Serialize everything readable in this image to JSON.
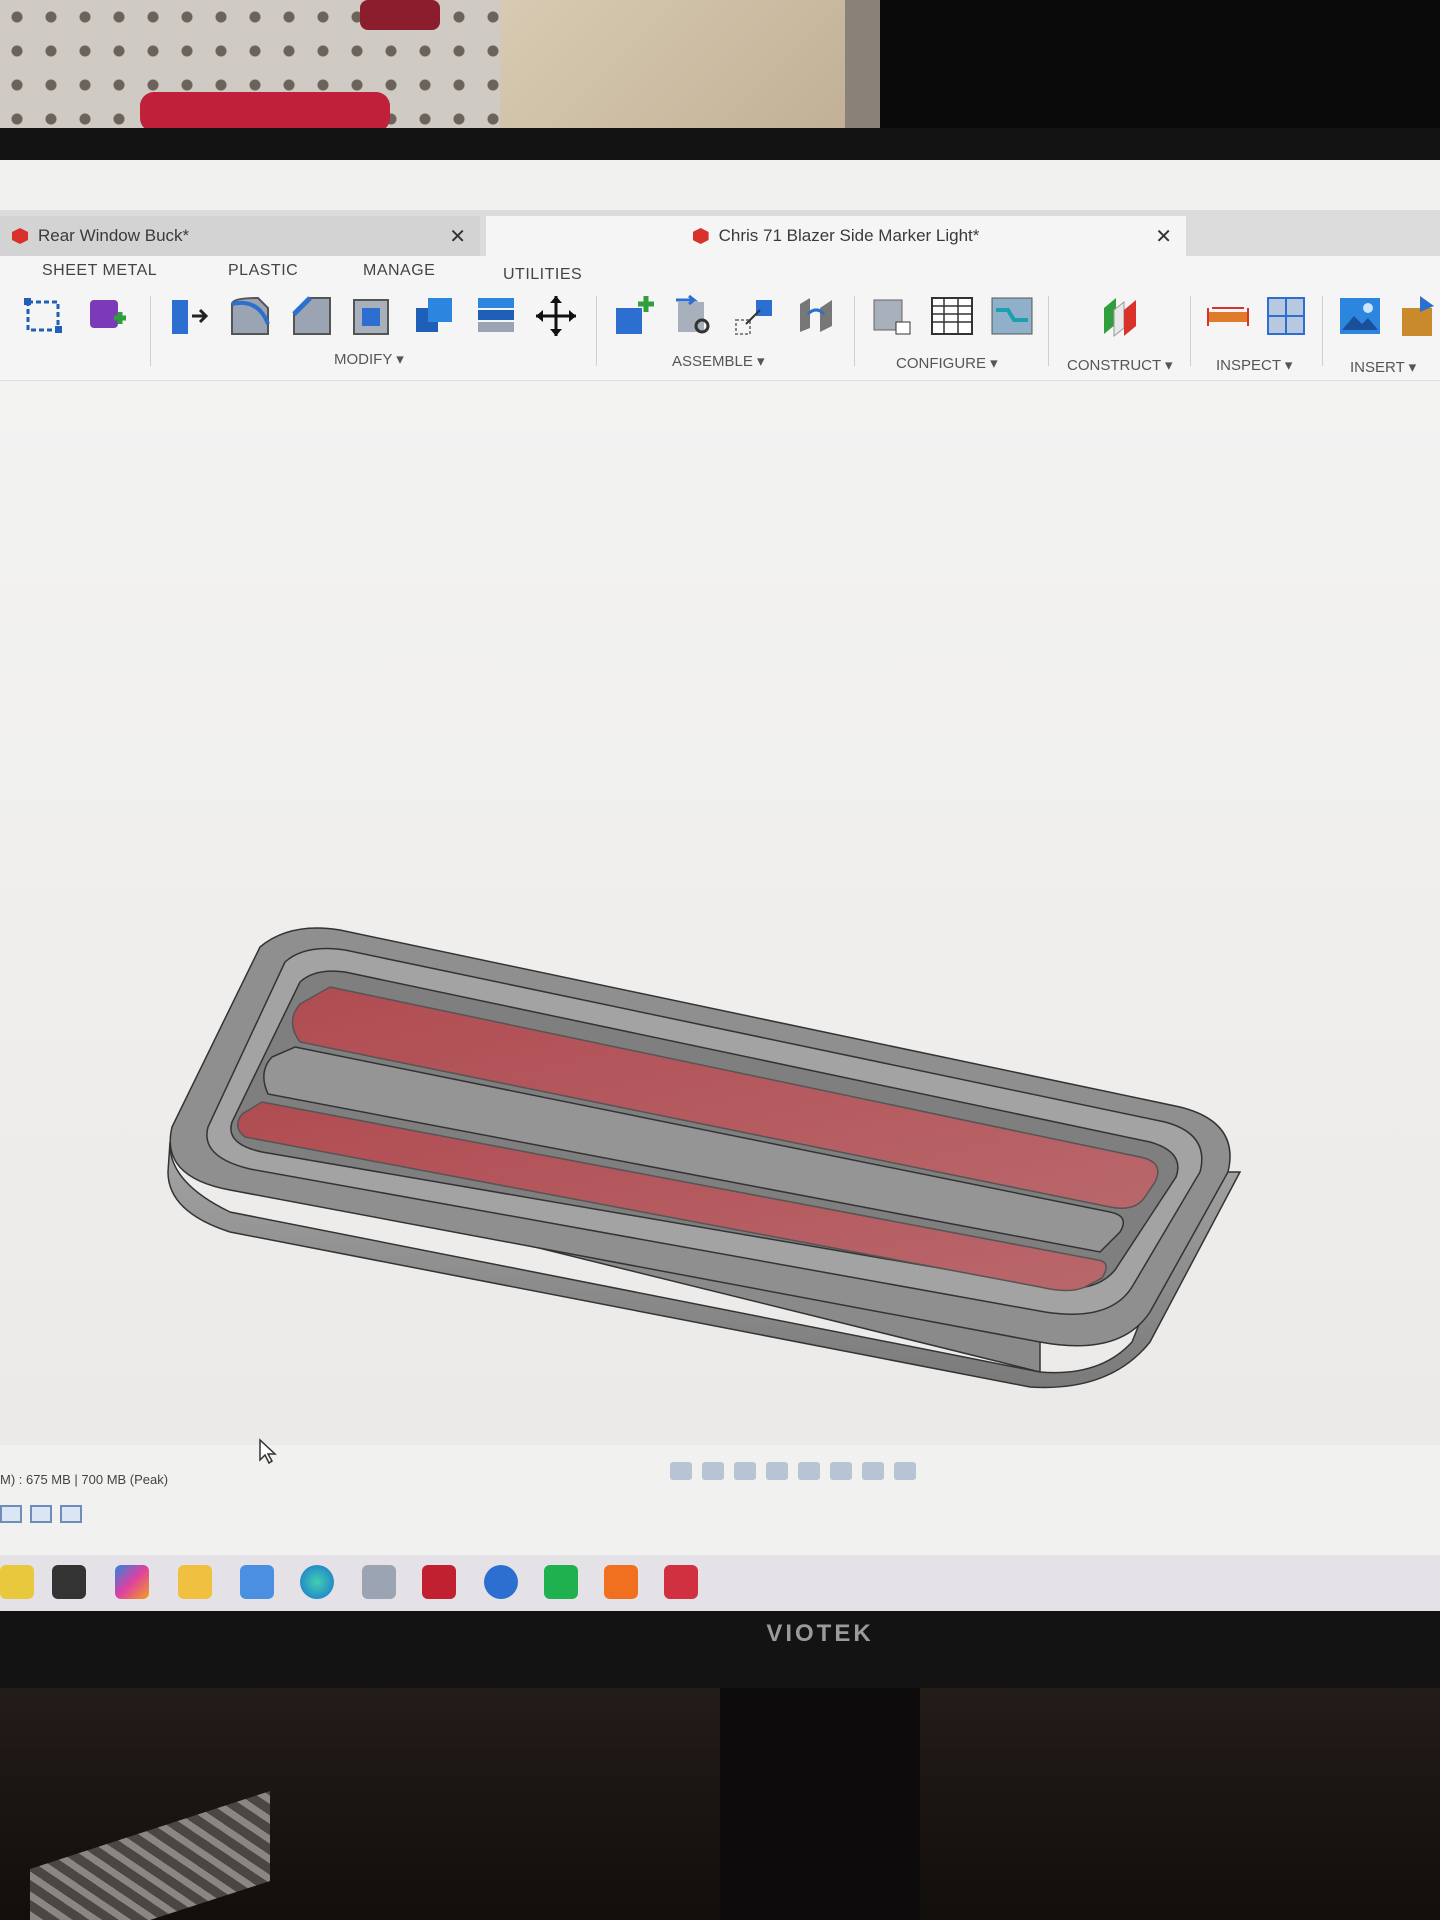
{
  "tabs": {
    "inactive_label": "Rear Window Buck*",
    "active_label": "Chris 71 Blazer Side Marker Light*"
  },
  "workspace_tabs": [
    "SHEET METAL",
    "PLASTIC",
    "MANAGE",
    "UTILITIES"
  ],
  "toolbar_groups": {
    "modify": "MODIFY ▾",
    "assemble": "ASSEMBLE ▾",
    "configure": "CONFIGURE ▾",
    "construct": "CONSTRUCT ▾",
    "inspect": "INSPECT ▾",
    "insert": "INSERT ▾"
  },
  "status": {
    "memory": "M) : 675 MB | 700 MB (Peak)"
  },
  "monitor_brand": "VIOTEK",
  "colors": {
    "accent_red": "#d8322b",
    "lens_red": "#b5565b",
    "body_gray": "#8d8d8d",
    "ui_bg": "#f5f5f5"
  }
}
